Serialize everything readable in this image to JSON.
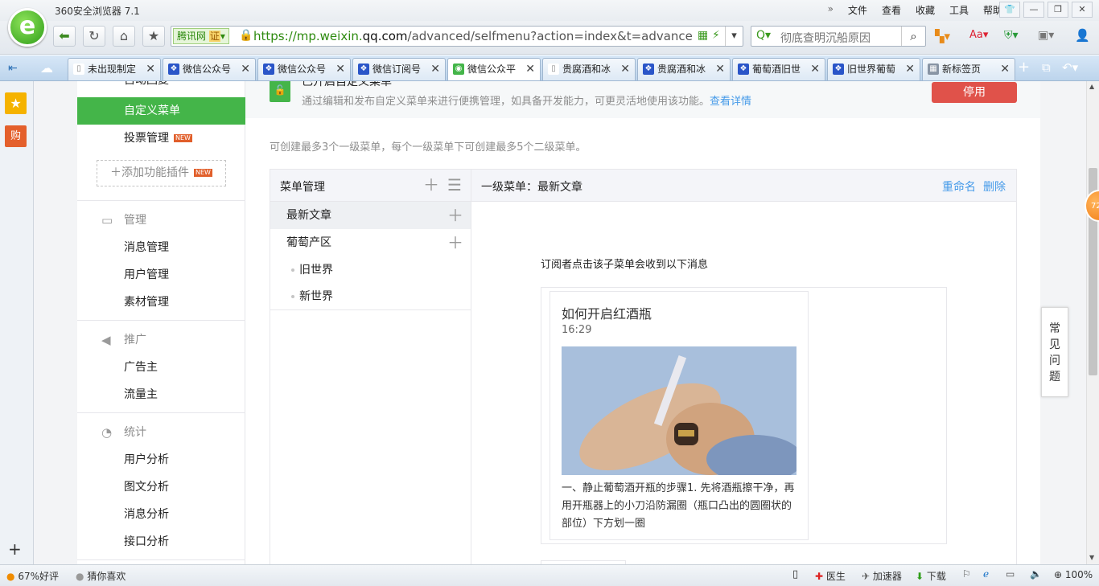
{
  "browser": {
    "title": "360安全浏览器 7.1",
    "menu": [
      "文件",
      "查看",
      "收藏",
      "工具",
      "帮助"
    ],
    "window_controls": [
      "minimize",
      "restore",
      "close"
    ],
    "address": {
      "badge": "腾讯网",
      "badge_cert": "证",
      "url_prefix": "https://mp.weixin.",
      "url_domain": "qq.com",
      "url_rest": "/advanced/selfmenu?action=index&t=advancec"
    },
    "search_placeholder": "彻底查明沉船原因"
  },
  "tabs": [
    {
      "label": "未出现制定",
      "icon": "page-icon",
      "active": false
    },
    {
      "label": "微信公众号",
      "icon": "paw-icon",
      "active": false
    },
    {
      "label": "微信公众号",
      "icon": "paw-icon",
      "active": false
    },
    {
      "label": "微信订阅号",
      "icon": "paw-icon",
      "active": false
    },
    {
      "label": "微信公众平",
      "icon": "wechat-icon",
      "active": true
    },
    {
      "label": "贵腐酒和冰",
      "icon": "page-icon",
      "active": false
    },
    {
      "label": "贵腐酒和冰",
      "icon": "paw-icon",
      "active": false
    },
    {
      "label": "葡萄酒旧世",
      "icon": "paw-icon",
      "active": false
    },
    {
      "label": "旧世界葡萄",
      "icon": "paw-icon",
      "active": false
    },
    {
      "label": "新标签页",
      "icon": "grid-icon",
      "active": false
    }
  ],
  "left_strip": {
    "star": "★",
    "shop": "购",
    "plus": "+"
  },
  "sidebar": {
    "top_partial": "自动回复",
    "custom_menu": "自定义菜单",
    "vote": "投票管理",
    "new_badge": "NEW",
    "add_plugin": "添加功能插件",
    "groups": [
      {
        "title": "管理",
        "icon": "inbox-icon",
        "items": [
          "消息管理",
          "用户管理",
          "素材管理"
        ]
      },
      {
        "title": "推广",
        "icon": "megaphone-icon",
        "items": [
          "广告主",
          "流量主"
        ]
      },
      {
        "title": "统计",
        "icon": "pie-icon",
        "items": [
          "用户分析",
          "图文分析",
          "消息分析",
          "接口分析"
        ]
      }
    ]
  },
  "main": {
    "notice_title": "已开启自定义菜单",
    "notice_desc": "通过编辑和发布自定义菜单来进行便携管理，如具备开发能力，可更灵活地使用该功能。",
    "notice_link": "查看详情",
    "stop_button": "停用",
    "tip": "可创建最多3个一级菜单，每个一级菜单下可创建最多5个二级菜单。",
    "menu_manage_title": "菜单管理",
    "menus": [
      {
        "label": "最新文章",
        "children": []
      },
      {
        "label": "葡萄产区",
        "children": [
          "旧世界",
          "新世界"
        ]
      }
    ],
    "right_title": "一级菜单：最新文章",
    "rename": "重命名",
    "delete": "删除",
    "subscriber_tip": "订阅者点击该子菜单会收到以下消息",
    "card": {
      "title": "如何开启红酒瓶",
      "time": "16:29",
      "summary": "一、静止葡萄酒开瓶的步骤1. 先将酒瓶擦干净，再用开瓶器上的小刀沿防漏圈（瓶口凸出的圆圈状的部位）下方划一圈"
    }
  },
  "float": {
    "faq": "常见问题",
    "ball": "72"
  },
  "status": {
    "rating": "67%好评",
    "guess": "猜你喜欢",
    "doctor": "医生",
    "accelerator": "加速器",
    "download": "下载",
    "zoom": "100%"
  }
}
